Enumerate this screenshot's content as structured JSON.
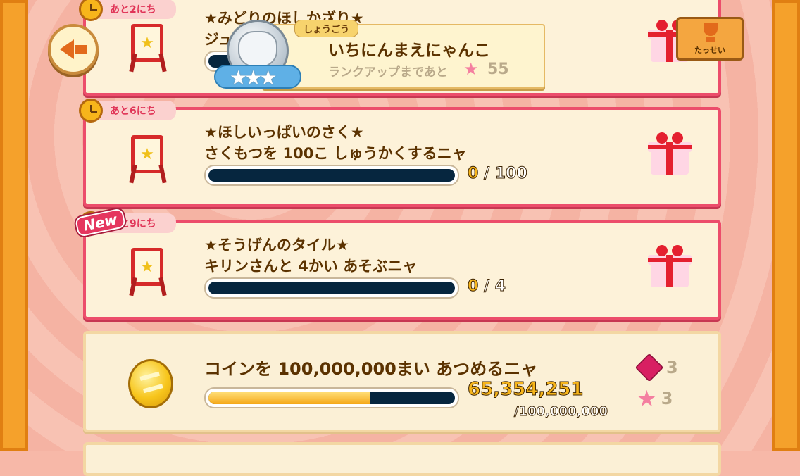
{
  "header": {
    "back_label": "",
    "rank": {
      "tag": "しょうごう",
      "name": "いちにんまえにゃんこ",
      "until_label": "ランクアップまであと",
      "until_value": "55"
    },
    "achievements_label": "たっせい"
  },
  "quests": [
    {
      "days": "あと2にち",
      "title": "★みどりのほしかざり★",
      "desc": "ジュ",
      "progress": 0
    },
    {
      "days": "あと6にち",
      "title": "★ほしいっぱいのさく★",
      "desc": "さくもつを 100こ しゅうかくするニャ",
      "current": "0",
      "slash": "/",
      "total": "100",
      "progress": 0
    },
    {
      "days": "あと9にち",
      "badge": "New",
      "title": "★そうげんのタイル★",
      "desc": "キリンさんと 4かい あそぶニャ",
      "current": "0",
      "slash": "/",
      "total": "4",
      "progress": 0
    }
  ],
  "coin_quest": {
    "desc": "コインを 100,000,000まい あつめるニャ",
    "current": "65,354,251",
    "goal": "/100,000,000",
    "progress": 0.6535,
    "reward_gem": "3",
    "reward_star": "3"
  },
  "colors": {
    "accent": "#ec4d6b",
    "bar_fill": "#f5a81a",
    "bar_track": "#06263f",
    "text_brown": "#5b3200"
  }
}
